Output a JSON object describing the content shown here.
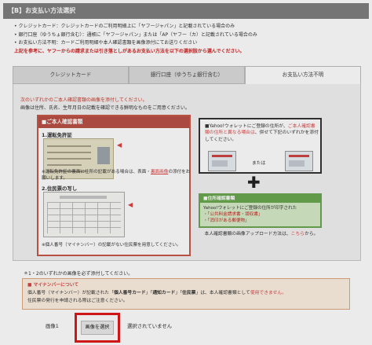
{
  "header": {
    "title": "【B】お支払い方法選択"
  },
  "intro": {
    "bullets": [
      "クレジットカード：クレジットカードのご利用明細上に「ヤフージャパン」と記載されている場合のみ",
      "銀行口座（ゆうちょ銀行含む）：通帳に「ヤフージャパン」または「AP（ヤフー（カ）と記載されている場合のみ",
      "お支払い方法不明：カードご利用明細や本人確認書類を画像添付にてお送りください"
    ],
    "warning": "上記を参考に、ヤフーからの請求または引き落としがあるお支払い方法を以下の選択肢から選んでください。"
  },
  "tabs": [
    {
      "label": "クレジットカード",
      "active": false
    },
    {
      "label": "銀行口座（ゆうちょ銀行含む）",
      "active": false
    },
    {
      "label": "お支払い方法不明",
      "active": true
    }
  ],
  "panel": {
    "intro_red": "次のいずれかのご本人確認書類の画像を添付してください。",
    "intro": "画像は住所、氏名、生年月日の記載を確認できる鮮明なものをご用意ください。",
    "id_box": {
      "head": "■ご本人確認書類",
      "item1": "1.運転免許証",
      "note1": "※運転免許証の裏面に住所の記載がある場合は、表面・",
      "note1_link": "裏面画像",
      "note1_end": "の添付をお願いします。",
      "item2": "2.住民票の写し",
      "note2": "※個人番号（マイナンバー）の記載がない住民票を用意してください。"
    },
    "yahoo_box": {
      "text_a": "■Yahoo!ウォレットにご登録の住所が、",
      "text_red": "ご本人確認書類の住所と異なる場合は",
      "text_b": "、併せて下記のいずれかを添付してください。",
      "or": "または"
    },
    "addr_box": {
      "head": "■住所確認書類",
      "text": "Yahoo!ウォレットにご登録の住所が印字された",
      "item1": "・「公共料金請求書・領収書」",
      "item2": "・「消印がある郵便物」"
    },
    "upload_note": "本人確認書類の画像アップロード方法は、",
    "upload_link": "こちら",
    "upload_end": "から。"
  },
  "required_note": "＊1・2のいずれかの画像を必ず添付してください。",
  "myna": {
    "title": "■ マイナンバーについて",
    "line1_a": "個人番号（マイナンバー）が記載された「",
    "line1_b": "個人番号カード",
    "line1_c": "」「",
    "line1_d": "通知カード",
    "line1_e": "」「",
    "line1_f": "住民票",
    "line1_g": "」は、本人確認書類として",
    "line1_red": "使用できません。",
    "line2": "住民票の発行を申請される際はご注意ください。"
  },
  "upload": {
    "label": "画像1",
    "button": "画像を選択",
    "status": "選択されていません"
  },
  "colors": {
    "header_bg": "#7f7f7f",
    "id_box_border": "#c9574a",
    "addr_box_border": "#6aa84f",
    "highlight": "#e01818"
  }
}
